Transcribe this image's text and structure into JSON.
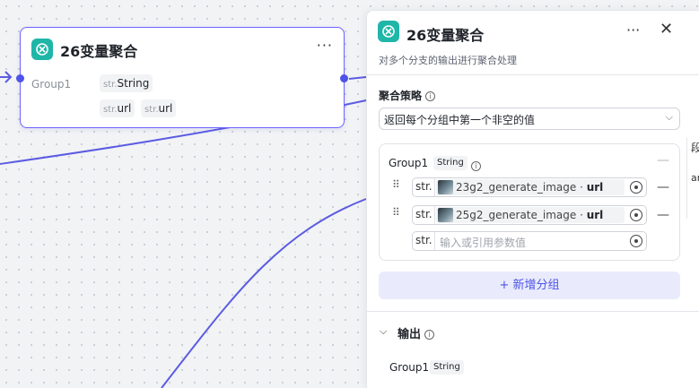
{
  "node": {
    "title": "26变量聚合",
    "more": "···",
    "group_label": "Group1",
    "inputs": [
      {
        "prefix": "str.",
        "label": "String"
      },
      {
        "prefix": "str.",
        "label": "url"
      },
      {
        "prefix": "str.",
        "label": "url"
      }
    ]
  },
  "panel": {
    "title": "26变量聚合",
    "more": "···",
    "close": "✕",
    "description": "对多个分支的输出进行聚合处理",
    "strategy_label": "聚合策略",
    "strategy_value": "返回每个分组中第一个非空的值",
    "group": {
      "name": "Group1",
      "type": "String",
      "collapse": "—",
      "vars": [
        {
          "prefix": "str.",
          "source": "23g2_generate_image",
          "dot": " · ",
          "field": "url",
          "remove": "—"
        },
        {
          "prefix": "str.",
          "source": "25g2_generate_image",
          "dot": " · ",
          "field": "url",
          "remove": "—"
        }
      ],
      "empty_prefix": "str.",
      "placeholder": "输入或引用参数值"
    },
    "add_group": "+ 新增分组",
    "output_label": "输出",
    "output_group": "Group1",
    "output_type": "String"
  },
  "ghost_text": [
    "段",
    "ar"
  ],
  "colors": {
    "accent": "#4d53e8",
    "node_icon": "#1fb6a8",
    "edge": "#5b5ce2"
  }
}
